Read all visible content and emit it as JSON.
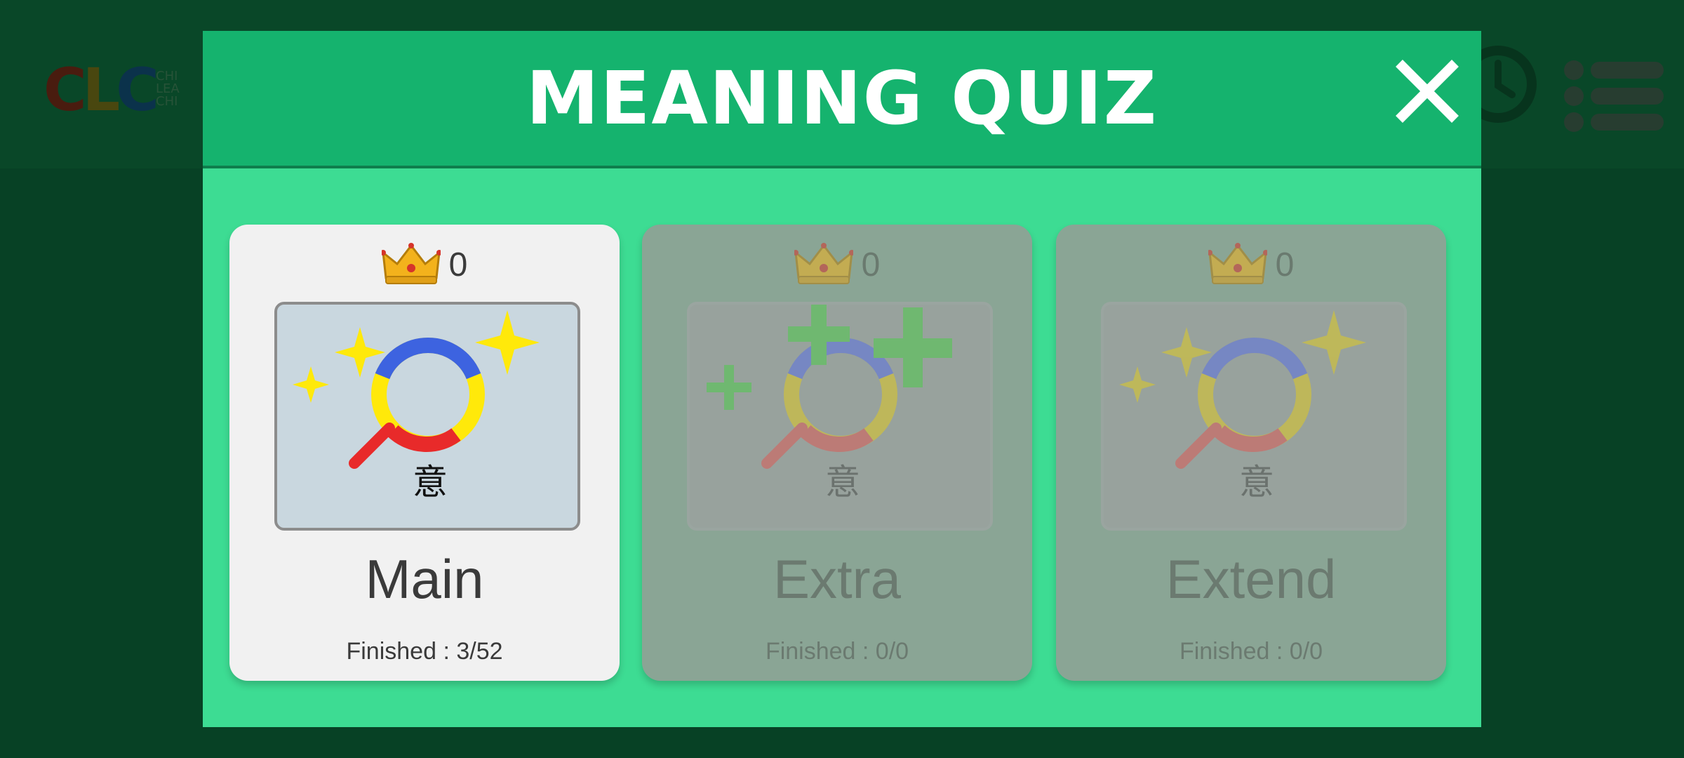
{
  "modal": {
    "title": "MEANING QUIZ",
    "close_icon": "close-icon"
  },
  "background": {
    "logo_text": "CLC",
    "logo_subtext": [
      "CHI",
      "LEA",
      "CHI"
    ],
    "icons": [
      "clock-icon",
      "menu-list-icon"
    ]
  },
  "cards": [
    {
      "name": "Main",
      "score": "0",
      "progress": "Finished : 3/52",
      "glyph": "意",
      "thumb_icon": "magnifier-sparkle-icon",
      "enabled": true
    },
    {
      "name": "Extra",
      "score": "0",
      "progress": "Finished : 0/0",
      "glyph": "意",
      "thumb_icon": "magnifier-plus-icon",
      "enabled": false
    },
    {
      "name": "Extend",
      "score": "0",
      "progress": "Finished : 0/0",
      "glyph": "意",
      "thumb_icon": "magnifier-sparkle-icon",
      "enabled": false
    }
  ],
  "colors": {
    "modal_bg": "#3ddc93",
    "header_bg": "#15b36e",
    "card_active": "#f1f1f1",
    "card_disabled": "#8aa595"
  }
}
